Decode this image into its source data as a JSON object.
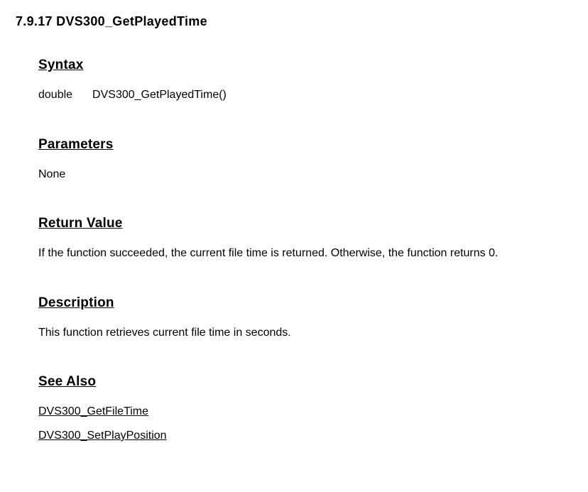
{
  "title": "7.9.17 DVS300_GetPlayedTime",
  "syntax": {
    "heading": "Syntax",
    "return_type": "double",
    "signature": "DVS300_GetPlayedTime()"
  },
  "parameters": {
    "heading": "Parameters",
    "text": "None"
  },
  "return_value": {
    "heading": "Return Value",
    "text": "If the function succeeded, the current file time is returned. Otherwise, the function returns 0."
  },
  "description": {
    "heading": "Description",
    "text": "This function retrieves current file time in seconds."
  },
  "see_also": {
    "heading": "See Also",
    "links": [
      "DVS300_GetFileTime",
      "DVS300_SetPlayPosition"
    ]
  }
}
